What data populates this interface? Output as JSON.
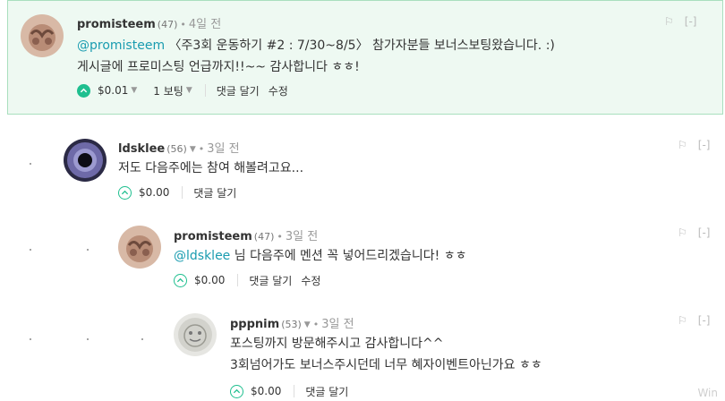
{
  "comments": [
    {
      "author": "promisteem",
      "rep": "(47)",
      "time": "4일 전",
      "mention": "@promisteem",
      "line1": " 〈주3회 운동하기 #2 : 7/30~8/5〉 참가자분들 보너스보팅왔습니다. :)",
      "line2": "게시글에 프로미스팅 언급까지!!~~ 감사합니다 ㅎㅎ!",
      "payout": "$0.01",
      "votes": "1 보팅",
      "reply": "댓글 달기",
      "edit": "수정"
    },
    {
      "author": "ldsklee",
      "rep": "(56)",
      "time": "3일 전",
      "line1": "저도 다음주에는 참여 해볼려고요...",
      "payout": "$0.00",
      "reply": "댓글 달기"
    },
    {
      "author": "promisteem",
      "rep": "(47)",
      "time": "3일 전",
      "mention": "@ldsklee",
      "line1": " 님 다음주에 멘션 꼭 넣어드리겠습니다! ㅎㅎ",
      "payout": "$0.00",
      "reply": "댓글 달기",
      "edit": "수정"
    },
    {
      "author": "pppnim",
      "rep": "(53)",
      "time": "3일 전",
      "line1": "포스팅까지 방문해주시고 감사합니다^^",
      "line2": "3회넘어가도 보너스주시던데 너무 혜자이벤트아닌가요 ㅎㅎ",
      "payout": "$0.00",
      "reply": "댓글 달기"
    }
  ],
  "flag_label": "⚐",
  "collapse_label": "[-]",
  "watermark": "Win",
  "colors": {
    "accent": "#1fbf8f",
    "mention": "#1a9cb0",
    "highlight_bg": "#eef9f2"
  }
}
